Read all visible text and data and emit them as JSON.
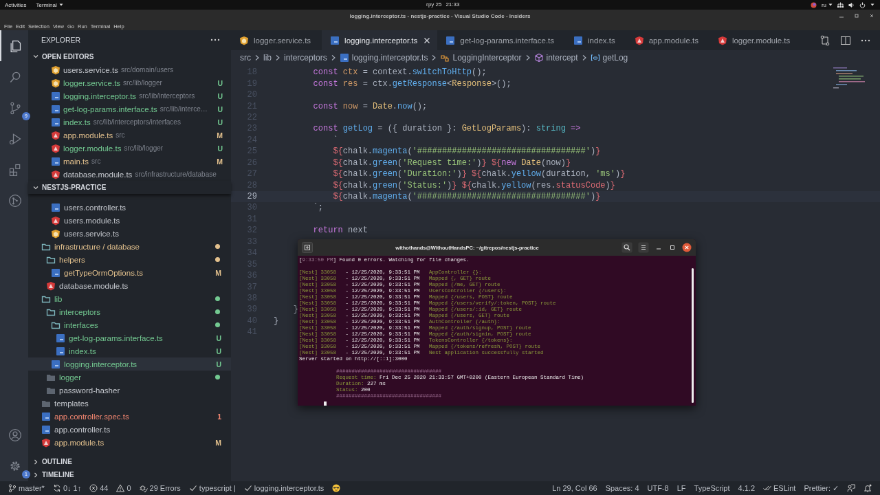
{
  "system_bar": {
    "activities": "Activities",
    "app_menu": "Terminal",
    "date": "гру 25",
    "time": "21:33",
    "keyboard_layout": "ru"
  },
  "window": {
    "title": "logging.interceptor.ts - nestjs-practice - Visual Studio Code - Insiders"
  },
  "menu": [
    "File",
    "Edit",
    "Selection",
    "View",
    "Go",
    "Run",
    "Terminal",
    "Help"
  ],
  "activity_bar": {
    "items": [
      {
        "kind": "explorer",
        "selected": true
      },
      {
        "kind": "search",
        "selected": false
      },
      {
        "kind": "source-control",
        "selected": false,
        "badge": "9"
      },
      {
        "kind": "run",
        "selected": false
      },
      {
        "kind": "extensions",
        "selected": false
      },
      {
        "kind": "git-graph",
        "selected": false
      }
    ],
    "bottom": [
      {
        "kind": "account"
      },
      {
        "kind": "settings",
        "badge": "1"
      }
    ]
  },
  "sidebar": {
    "title": "EXPLORER",
    "open_editors": {
      "title": "OPEN EDITORS",
      "expanded": true,
      "items": [
        {
          "name": "users.service.ts",
          "path": "src/domain/users",
          "kind": "service",
          "selected": false
        },
        {
          "name": "logger.service.ts",
          "path": "src/lib/logger",
          "kind": "service",
          "color": "#73c991",
          "badge": "U",
          "selected": false
        },
        {
          "name": "logging.interceptor.ts",
          "path": "src/lib/interceptors",
          "kind": "ts",
          "color": "#73c991",
          "badge": "U",
          "selected": false
        },
        {
          "name": "get-log-params.interface.ts",
          "path": "src/lib/interce…",
          "kind": "ts",
          "color": "#73c991",
          "badge": "U",
          "selected": false
        },
        {
          "name": "index.ts",
          "path": "src/lib/interceptors/interfaces",
          "kind": "ts",
          "color": "#73c991",
          "badge": "U",
          "selected": false
        },
        {
          "name": "app.module.ts",
          "path": "src",
          "kind": "angular",
          "color": "#e2c08d",
          "badge": "M",
          "selected": false
        },
        {
          "name": "logger.module.ts",
          "path": "src/lib/logger",
          "kind": "angular",
          "color": "#73c991",
          "badge": "U",
          "selected": false
        },
        {
          "name": "main.ts",
          "path": "src",
          "kind": "ts",
          "color": "#e2c08d",
          "badge": "M",
          "selected": false
        },
        {
          "name": "database.module.ts",
          "path": "src/infrastructure/database",
          "kind": "angular",
          "selected": false
        }
      ]
    },
    "project": {
      "title": "NESTJS-PRACTICE",
      "expanded": true,
      "tree": [
        {
          "children": [
            {
              "children": [
                {
                  "name": "users.controller.ts",
                  "kind": "ts",
                  "selected": false
                },
                {
                  "name": "users.module.ts",
                  "kind": "angular",
                  "selected": false
                },
                {
                  "name": "users.service.ts",
                  "kind": "service",
                  "selected": false
                }
              ]
            }
          ]
        },
        {
          "name": "infrastructure / database",
          "kind": "folder",
          "expanded": true,
          "color": "#e2c08d",
          "dot": true,
          "selected": false,
          "children": [
            {
              "name": "helpers",
              "kind": "folder",
              "expanded": true,
              "color": "#e2c08d",
              "dot": true,
              "selected": false,
              "children": [
                {
                  "name": "getTypeOrmOptions.ts",
                  "kind": "ts",
                  "color": "#e2c08d",
                  "badge": "M",
                  "selected": false
                }
              ]
            },
            {
              "name": "database.module.ts",
              "kind": "angular",
              "selected": false
            }
          ]
        },
        {
          "name": "lib",
          "kind": "folder",
          "expanded": true,
          "color": "#73c991",
          "dot": true,
          "selected": false,
          "children": [
            {
              "name": "interceptors",
              "kind": "folder",
              "expanded": true,
              "color": "#73c991",
              "dot": true,
              "selected": false,
              "children": [
                {
                  "name": "interfaces",
                  "kind": "folder",
                  "expanded": true,
                  "color": "#73c991",
                  "dot": true,
                  "selected": false,
                  "children": [
                    {
                      "name": "get-log-params.interface.ts",
                      "kind": "ts",
                      "color": "#73c991",
                      "badge": "U",
                      "selected": false
                    },
                    {
                      "name": "index.ts",
                      "kind": "ts",
                      "color": "#73c991",
                      "badge": "U",
                      "selected": false
                    }
                  ]
                },
                {
                  "name": "logging.interceptor.ts",
                  "kind": "ts",
                  "color": "#73c991",
                  "badge": "U",
                  "selected": true
                }
              ]
            },
            {
              "name": "logger",
              "kind": "folder",
              "expanded": false,
              "color": "#73c991",
              "dot": true,
              "selected": false
            },
            {
              "name": "password-hasher",
              "kind": "folder",
              "expanded": false,
              "dot": false,
              "selected": false
            }
          ]
        },
        {
          "name": "templates",
          "kind": "folder",
          "expanded": false,
          "dot": false,
          "selected": false
        },
        {
          "name": "app.controller.spec.ts",
          "kind": "ts",
          "color": "#f48771",
          "badge": "1",
          "selected": false
        },
        {
          "name": "app.controller.ts",
          "kind": "ts",
          "selected": false
        },
        {
          "name": "app.module.ts",
          "kind": "angular",
          "color": "#e2c08d",
          "badge": "M",
          "selected": false
        }
      ]
    },
    "sections": [
      {
        "title": "OUTLINE",
        "expanded": false
      },
      {
        "title": "TIMELINE",
        "expanded": false
      }
    ]
  },
  "editor": {
    "tabs": [
      {
        "label": "logger.service.ts",
        "kind": "service",
        "selected": false
      },
      {
        "label": "logging.interceptor.ts",
        "kind": "ts",
        "selected": true
      },
      {
        "label": "get-log-params.interface.ts",
        "kind": "ts",
        "selected": false
      },
      {
        "label": "index.ts",
        "kind": "ts",
        "selected": false
      },
      {
        "label": "app.module.ts",
        "kind": "angular",
        "selected": false
      },
      {
        "label": "logger.module.ts",
        "kind": "angular",
        "selected": false
      }
    ],
    "breadcrumbs": [
      {
        "text": "src",
        "kind": "folder"
      },
      {
        "text": "lib",
        "kind": "folder"
      },
      {
        "text": "interceptors",
        "kind": "folder"
      },
      {
        "text": "logging.interceptor.ts",
        "kind": "ts"
      },
      {
        "text": "LoggingInterceptor",
        "kind": "class"
      },
      {
        "text": "intercept",
        "kind": "method"
      },
      {
        "text": "getLog",
        "kind": "field"
      }
    ],
    "lines": [
      {
        "number": "18",
        "current": false,
        "tokens": [
          {
            "kind": "kw",
            "text": "        const "
          },
          {
            "kind": "var",
            "text": "ctx"
          },
          {
            "kind": "p",
            "text": " = context."
          },
          {
            "kind": "fn",
            "text": "switchToHttp"
          },
          {
            "kind": "p",
            "text": "();"
          }
        ]
      },
      {
        "number": "19",
        "current": false,
        "tokens": [
          {
            "kind": "kw",
            "text": "        const "
          },
          {
            "kind": "var",
            "text": "res"
          },
          {
            "kind": "p",
            "text": " = ctx."
          },
          {
            "kind": "fn",
            "text": "getResponse"
          },
          {
            "kind": "p",
            "text": "<"
          },
          {
            "kind": "type",
            "text": "Response"
          },
          {
            "kind": "p",
            "text": ">();"
          }
        ]
      },
      {
        "number": "20",
        "current": false
      },
      {
        "number": "21",
        "current": false,
        "tokens": [
          {
            "kind": "kw",
            "text": "        const "
          },
          {
            "kind": "var",
            "text": "now"
          },
          {
            "kind": "p",
            "text": " = "
          },
          {
            "kind": "type",
            "text": "Date"
          },
          {
            "kind": "p",
            "text": "."
          },
          {
            "kind": "fn",
            "text": "now"
          },
          {
            "kind": "p",
            "text": "();"
          }
        ]
      },
      {
        "number": "22",
        "current": false
      },
      {
        "number": "23",
        "current": false,
        "tokens": [
          {
            "kind": "kw",
            "text": "        const "
          },
          {
            "kind": "fn",
            "text": "getLog"
          },
          {
            "kind": "p",
            "text": " = ({ duration }: "
          },
          {
            "kind": "type",
            "text": "GetLogParams"
          },
          {
            "kind": "p",
            "text": "): "
          },
          {
            "kind": "builtin",
            "text": "string"
          },
          {
            "kind": "kw",
            "text": " =>"
          }
        ]
      },
      {
        "number": "24",
        "current": false,
        "tokens": [
          {
            "kind": "p",
            "text": "            `"
          }
        ]
      },
      {
        "number": "25",
        "current": false,
        "tokens": [
          {
            "kind": "tpl",
            "text": "            ${"
          },
          {
            "kind": "p",
            "text": "chalk."
          },
          {
            "kind": "fn",
            "text": "magenta"
          },
          {
            "kind": "p",
            "text": "("
          },
          {
            "kind": "str",
            "text": "'##################################'"
          },
          {
            "kind": "p",
            "text": ")"
          },
          {
            "kind": "tpl",
            "text": "}"
          }
        ]
      },
      {
        "number": "26",
        "current": false,
        "tokens": [
          {
            "kind": "tpl",
            "text": "            ${"
          },
          {
            "kind": "p",
            "text": "chalk."
          },
          {
            "kind": "fn",
            "text": "green"
          },
          {
            "kind": "p",
            "text": "("
          },
          {
            "kind": "str",
            "text": "'Request time:'"
          },
          {
            "kind": "p",
            "text": ")"
          },
          {
            "kind": "tpl",
            "text": "} ${"
          },
          {
            "kind": "kw",
            "text": "new "
          },
          {
            "kind": "type",
            "text": "Date"
          },
          {
            "kind": "p",
            "text": "(now)"
          },
          {
            "kind": "tpl",
            "text": "}"
          }
        ]
      },
      {
        "number": "27",
        "current": false,
        "tokens": [
          {
            "kind": "tpl",
            "text": "            ${"
          },
          {
            "kind": "p",
            "text": "chalk."
          },
          {
            "kind": "fn",
            "text": "green"
          },
          {
            "kind": "p",
            "text": "("
          },
          {
            "kind": "str",
            "text": "'Duration:'"
          },
          {
            "kind": "p",
            "text": ")"
          },
          {
            "kind": "tpl",
            "text": "} ${"
          },
          {
            "kind": "p",
            "text": "chalk."
          },
          {
            "kind": "fn",
            "text": "yellow"
          },
          {
            "kind": "p",
            "text": "(duration, "
          },
          {
            "kind": "str",
            "text": "'ms'"
          },
          {
            "kind": "p",
            "text": ")"
          },
          {
            "kind": "tpl",
            "text": "}"
          }
        ]
      },
      {
        "number": "28",
        "current": false,
        "tokens": [
          {
            "kind": "tpl",
            "text": "            ${"
          },
          {
            "kind": "p",
            "text": "chalk."
          },
          {
            "kind": "fn",
            "text": "green"
          },
          {
            "kind": "p",
            "text": "("
          },
          {
            "kind": "str",
            "text": "'Status:'"
          },
          {
            "kind": "p",
            "text": ")"
          },
          {
            "kind": "tpl",
            "text": "} ${"
          },
          {
            "kind": "p",
            "text": "chalk."
          },
          {
            "kind": "fn",
            "text": "yellow"
          },
          {
            "kind": "p",
            "text": "(res."
          },
          {
            "kind": "prop",
            "text": "statusCode"
          },
          {
            "kind": "p",
            "text": ")"
          },
          {
            "kind": "tpl",
            "text": "}"
          }
        ]
      },
      {
        "number": "29",
        "current": true,
        "tokens": [
          {
            "kind": "tpl",
            "text": "            ${"
          },
          {
            "kind": "p",
            "text": "chalk."
          },
          {
            "kind": "fn",
            "text": "magenta"
          },
          {
            "kind": "p",
            "text": "("
          },
          {
            "kind": "str",
            "text": "'##################################'"
          },
          {
            "kind": "p",
            "text": ")"
          },
          {
            "kind": "tpl",
            "text": "}"
          }
        ]
      },
      {
        "number": "30",
        "current": false,
        "tokens": [
          {
            "kind": "p",
            "text": "        `;"
          }
        ]
      },
      {
        "number": "31",
        "current": false
      },
      {
        "number": "32",
        "current": false,
        "tokens": [
          {
            "kind": "kw",
            "text": "        return "
          },
          {
            "kind": "p",
            "text": "next"
          }
        ]
      },
      {
        "number": "33",
        "current": false
      },
      {
        "number": "34",
        "current": false
      },
      {
        "number": "35",
        "current": false
      },
      {
        "number": "36",
        "current": false
      },
      {
        "number": "37",
        "current": false
      },
      {
        "number": "38",
        "current": false
      },
      {
        "number": "39",
        "current": false,
        "tokens": [
          {
            "kind": "p",
            "text": "    }"
          }
        ]
      },
      {
        "number": "40",
        "current": false,
        "tokens": [
          {
            "kind": "p",
            "text": "}"
          }
        ]
      },
      {
        "number": "41",
        "current": false
      }
    ]
  },
  "terminal": {
    "title": "withothands@WithoutHandsPC: ~/gitrepos/nestjs-practice",
    "watch_line": {
      "open": "[",
      "time": "9:33:50 PM",
      "text": "] Found 0 errors. Watching for file changes."
    },
    "logs": [
      {
        "tag": "[Nest] 33058",
        "sep": "-",
        "time": "12/25/2020, 9:33:51 PM",
        "message": "AppController {}:"
      },
      {
        "tag": "[Nest] 33058",
        "sep": "-",
        "time": "12/25/2020, 9:33:51 PM",
        "message": "Mapped {, GET} route"
      },
      {
        "tag": "[Nest] 33058",
        "sep": "-",
        "time": "12/25/2020, 9:33:51 PM",
        "message": "Mapped {/me, GET} route"
      },
      {
        "tag": "[Nest] 33058",
        "sep": "-",
        "time": "12/25/2020, 9:33:51 PM",
        "message": "UsersController {/users}:"
      },
      {
        "tag": "[Nest] 33058",
        "sep": "-",
        "time": "12/25/2020, 9:33:51 PM",
        "message": "Mapped {/users, POST} route"
      },
      {
        "tag": "[Nest] 33058",
        "sep": "-",
        "time": "12/25/2020, 9:33:51 PM",
        "message": "Mapped {/users/verify/:token, POST} route"
      },
      {
        "tag": "[Nest] 33058",
        "sep": "-",
        "time": "12/25/2020, 9:33:51 PM",
        "message": "Mapped {/users/:id, GET} route"
      },
      {
        "tag": "[Nest] 33058",
        "sep": "-",
        "time": "12/25/2020, 9:33:51 PM",
        "message": "Mapped {/users, GET} route"
      },
      {
        "tag": "[Nest] 33058",
        "sep": "-",
        "time": "12/25/2020, 9:33:51 PM",
        "message": "AuthController {/auth}:"
      },
      {
        "tag": "[Nest] 33058",
        "sep": "-",
        "time": "12/25/2020, 9:33:51 PM",
        "message": "Mapped {/auth/signup, POST} route"
      },
      {
        "tag": "[Nest] 33058",
        "sep": "-",
        "time": "12/25/2020, 9:33:51 PM",
        "message": "Mapped {/auth/signin, POST} route"
      },
      {
        "tag": "[Nest] 33058",
        "sep": "-",
        "time": "12/25/2020, 9:33:51 PM",
        "message": "TokensController {/tokens}:"
      },
      {
        "tag": "[Nest] 33058",
        "sep": "-",
        "time": "12/25/2020, 9:33:51 PM",
        "message": "Mapped {/tokens/refresh, POST} route"
      },
      {
        "tag": "[Nest] 33058",
        "sep": "-",
        "time": "12/25/2020, 9:33:51 PM",
        "message": "Nest application successfully started"
      }
    ],
    "server_line": "Server started on http://[::1]:3000",
    "report": [
      {
        "kind": "rule",
        "text": "##################################"
      },
      {
        "kind": "field",
        "label": "Request time:",
        "value": "Fri Dec 25 2020 21:33:57 GMT+0200 (Eastern European Standard Time)"
      },
      {
        "kind": "field",
        "label": "Duration:",
        "value": "227 ms"
      },
      {
        "kind": "field",
        "label": "Status:",
        "value": "200"
      },
      {
        "kind": "rule",
        "text": "##################################"
      }
    ]
  },
  "status_bar": {
    "left": [
      {
        "kind": "branch",
        "text": "master*"
      },
      {
        "kind": "sync",
        "text": "0↓ 1↑"
      },
      {
        "kind": "errors",
        "text": "44"
      },
      {
        "kind": "warnings",
        "text": "0"
      },
      {
        "kind": "lint",
        "text": "29 Errors"
      },
      {
        "kind": "check",
        "text": "typescript |"
      },
      {
        "kind": "check",
        "text": "logging.interceptor.ts"
      },
      {
        "kind": "emoji"
      }
    ],
    "right": [
      {
        "kind": "text",
        "text": "Ln 29, Col 66"
      },
      {
        "kind": "text",
        "text": "Spaces: 4"
      },
      {
        "kind": "text",
        "text": "UTF-8"
      },
      {
        "kind": "text",
        "text": "LF"
      },
      {
        "kind": "text",
        "text": "TypeScript"
      },
      {
        "kind": "text",
        "text": "4.1.2"
      },
      {
        "kind": "eslint",
        "text": "ESLint"
      },
      {
        "kind": "text",
        "text": "Prettier: ✓"
      },
      {
        "kind": "feedback"
      },
      {
        "kind": "bell"
      }
    ]
  }
}
